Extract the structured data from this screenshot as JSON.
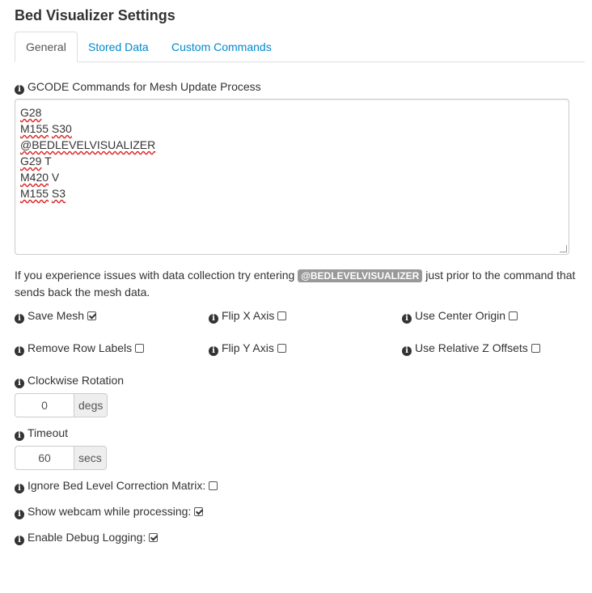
{
  "title": "Bed Visualizer Settings",
  "tabs": [
    {
      "label": "General"
    },
    {
      "label": "Stored Data"
    },
    {
      "label": "Custom Commands"
    }
  ],
  "gcode": {
    "label": "GCODE Commands for Mesh Update Process",
    "lines": [
      {
        "spell": "G28",
        "rest": ""
      },
      {
        "spell": "M155",
        "rest": " ",
        "spell2": "S30"
      },
      {
        "spell": "@BEDLEVELVISUALIZER",
        "rest": ""
      },
      {
        "spell": "G29",
        "rest": " T"
      },
      {
        "spell": "M420",
        "rest": " V"
      },
      {
        "spell": "M155",
        "rest": " ",
        "spell2": "S3"
      }
    ]
  },
  "help": {
    "before": "If you experience issues with data collection try entering ",
    "code": "@BEDLEVELVISUALIZER",
    "after": " just prior to the command that sends back the mesh data."
  },
  "options": {
    "save_mesh": {
      "label": "Save Mesh",
      "checked": true
    },
    "flip_x": {
      "label": "Flip X Axis",
      "checked": false
    },
    "center_origin": {
      "label": "Use Center Origin",
      "checked": false
    },
    "remove_row_labels": {
      "label": "Remove Row Labels",
      "checked": false
    },
    "flip_y": {
      "label": "Flip Y Axis",
      "checked": false
    },
    "relative_z": {
      "label": "Use Relative Z Offsets",
      "checked": false
    }
  },
  "rotation": {
    "label": "Clockwise Rotation",
    "value": "0",
    "unit": "degs"
  },
  "timeout": {
    "label": "Timeout",
    "value": "60",
    "unit": "secs"
  },
  "ignore_matrix": {
    "label": "Ignore Bed Level Correction Matrix:",
    "checked": false
  },
  "show_webcam": {
    "label": "Show webcam while processing:",
    "checked": true
  },
  "debug_logging": {
    "label": "Enable Debug Logging:",
    "checked": true
  },
  "icons": {
    "info": "info-circle-icon",
    "glyph": "i"
  }
}
